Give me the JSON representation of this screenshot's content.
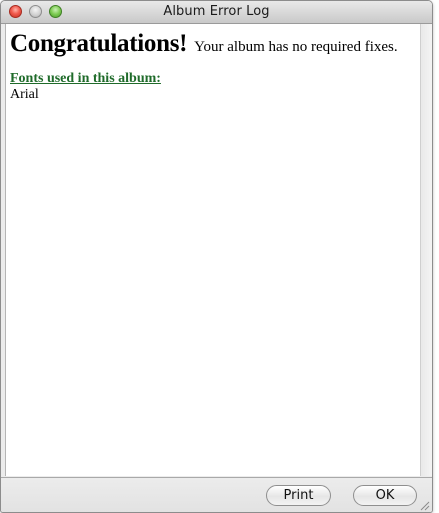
{
  "window": {
    "title": "Album Error Log"
  },
  "content": {
    "heading": "Congratulations!",
    "message": "Your album has no required fixes.",
    "fonts_title": "Fonts used in this album:",
    "fonts": [
      "Arial"
    ]
  },
  "footer": {
    "print_label": "Print",
    "ok_label": "OK"
  },
  "icons": {
    "close": "close-icon",
    "minimize": "minimize-icon",
    "zoom": "zoom-icon",
    "resize": "resize-grip-icon"
  },
  "colors": {
    "fonts_title": "#1f6b2a"
  }
}
